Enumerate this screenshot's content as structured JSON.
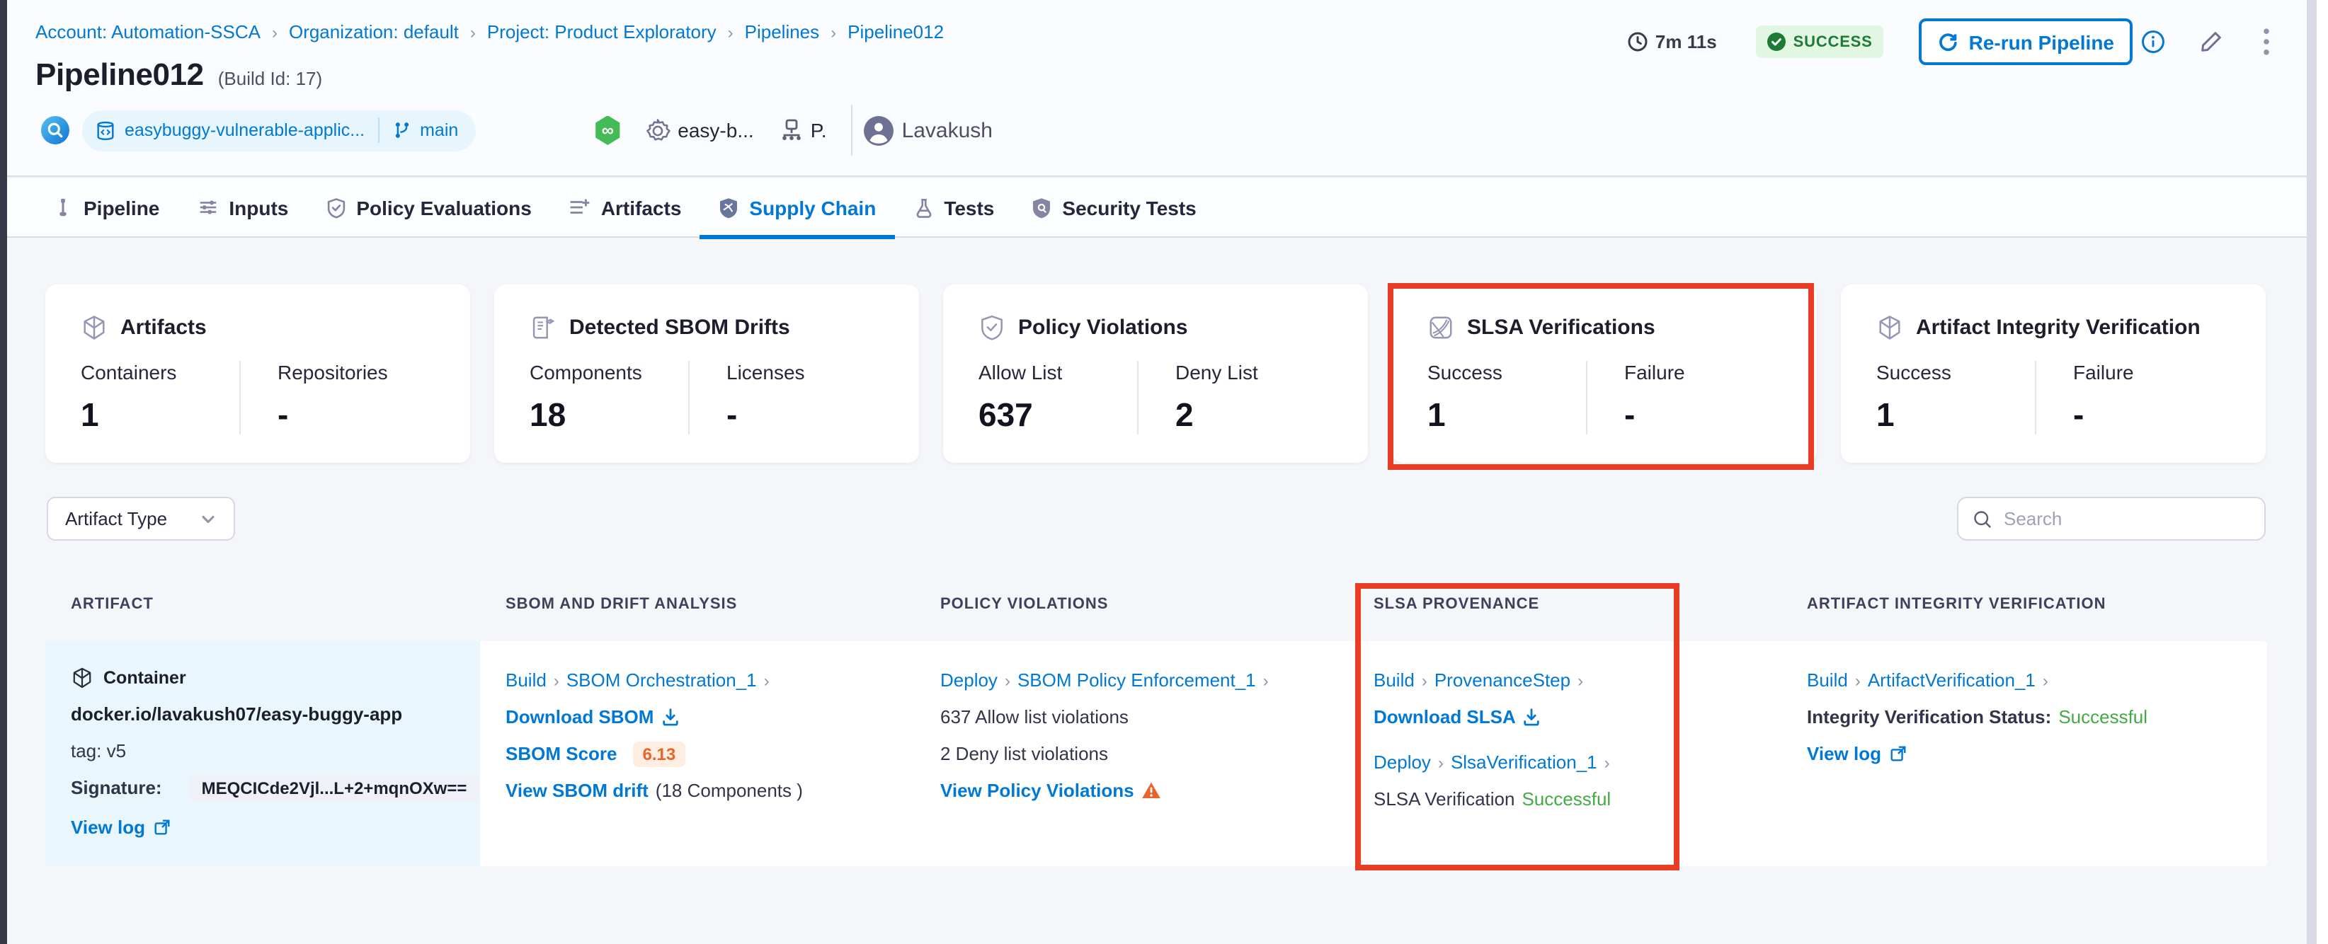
{
  "breadcrumb": {
    "items": [
      "Account: Automation-SSCA",
      "Organization: default",
      "Project: Product Exploratory",
      "Pipelines",
      "Pipeline012"
    ]
  },
  "header": {
    "title": "Pipeline012",
    "build_id": "(Build Id: 17)",
    "repo_name": "easybuggy-vulnerable-applic...",
    "branch": "main",
    "service_label": "easy-b...",
    "env_label": "P.",
    "user_name": "Lavakush",
    "duration": "7m 11s",
    "status": "SUCCESS",
    "rerun_label": "Re-run Pipeline"
  },
  "tabs": [
    {
      "label": "Pipeline"
    },
    {
      "label": "Inputs"
    },
    {
      "label": "Policy Evaluations"
    },
    {
      "label": "Artifacts"
    },
    {
      "label": "Supply Chain"
    },
    {
      "label": "Tests"
    },
    {
      "label": "Security Tests"
    }
  ],
  "cards": [
    {
      "title": "Artifacts",
      "cols": [
        {
          "label": "Containers",
          "value": "1"
        },
        {
          "label": "Repositories",
          "value": "-"
        }
      ]
    },
    {
      "title": "Detected SBOM Drifts",
      "cols": [
        {
          "label": "Components",
          "value": "18"
        },
        {
          "label": "Licenses",
          "value": "-"
        }
      ]
    },
    {
      "title": "Policy Violations",
      "cols": [
        {
          "label": "Allow List",
          "value": "637"
        },
        {
          "label": "Deny List",
          "value": "2"
        }
      ]
    },
    {
      "title": "SLSA Verifications",
      "cols": [
        {
          "label": "Success",
          "value": "1"
        },
        {
          "label": "Failure",
          "value": "-"
        }
      ]
    },
    {
      "title": "Artifact Integrity Verification",
      "cols": [
        {
          "label": "Success",
          "value": "1"
        },
        {
          "label": "Failure",
          "value": "-"
        }
      ]
    }
  ],
  "filters": {
    "artifact_type_label": "Artifact Type",
    "search_placeholder": "Search"
  },
  "table": {
    "headers": [
      "ARTIFACT",
      "SBOM AND DRIFT ANALYSIS",
      "POLICY VIOLATIONS",
      "SLSA PROVENANCE",
      "ARTIFACT INTEGRITY VERIFICATION"
    ],
    "row": {
      "artifact": {
        "type_label": "Container",
        "name": "docker.io/lavakush07/easy-buggy-app",
        "tag": "tag: v5",
        "signature_label": "Signature:",
        "signature_value": "MEQCICde2Vjl...L+2+mqnOXw==",
        "view_log_label": "View log"
      },
      "sbom": {
        "stage": "Build",
        "step": "SBOM Orchestration_1",
        "download_label": "Download SBOM",
        "score_label": "SBOM Score",
        "score_value": "6.13",
        "drift_label": "View SBOM drift",
        "drift_note": "(18 Components )"
      },
      "policy": {
        "stage": "Deploy",
        "step": "SBOM Policy Enforcement_1",
        "allow_text": "637 Allow list violations",
        "deny_text": "2 Deny list violations",
        "view_label": "View Policy Violations"
      },
      "slsa": {
        "stage1": "Build",
        "step1": "ProvenanceStep",
        "download_label": "Download SLSA",
        "stage2": "Deploy",
        "step2": "SlsaVerification_1",
        "status_label": "SLSA Verification",
        "status_value": "Successful"
      },
      "integrity": {
        "stage": "Build",
        "step": "ArtifactVerification_1",
        "status_label": "Integrity Verification Status:",
        "status_value": "Successful",
        "view_log_label": "View log"
      }
    }
  },
  "colors": {
    "accent_blue": "#0278d5",
    "success_green": "#42ab45",
    "annotation_red": "#e93c25",
    "warning_orange": "#e8652a"
  }
}
